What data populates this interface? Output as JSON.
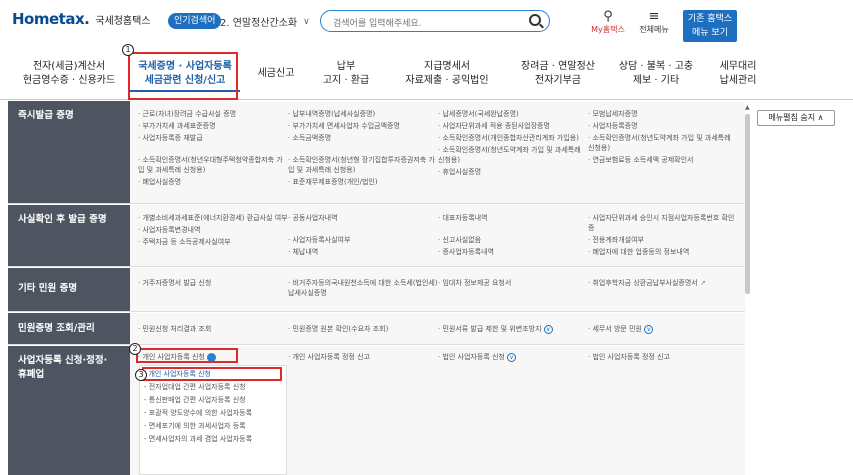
{
  "header": {
    "logo_text": "Hometax.",
    "logo_ko": "국세청홈택스",
    "popular_badge": "인기검색어",
    "popular_selected": "2. 연말정산간소화",
    "search_placeholder": "검색어를 입력해주세요.",
    "my_hometax": "My홈택스",
    "all_menu": "전체메뉴",
    "basic_menu_line1": "기존 홈택스",
    "basic_menu_line2": "메뉴 보기"
  },
  "nav": {
    "items": [
      {
        "line1": "전자(세금)계산서",
        "line2": "현금영수증 · 신용카드"
      },
      {
        "line1": "국세증명 · 사업자등록",
        "line2": "세금관련 신청/신고"
      },
      {
        "line1": "세금신고",
        "line2": ""
      },
      {
        "line1": "납부",
        "line2": "고지 · 환급"
      },
      {
        "line1": "지급명세서",
        "line2": "자료제출 · 공익법인"
      },
      {
        "line1": "장려금 · 연말정산",
        "line2": "전자기부금"
      },
      {
        "line1": "상담 · 불복 · 고충",
        "line2": "제보 · 기타"
      },
      {
        "line1": "세무대리",
        "line2": "납세관리"
      }
    ]
  },
  "annotations": {
    "n1": "1",
    "n2": "2",
    "n3": "3"
  },
  "sections": {
    "s1": {
      "label": "즉시발급 증명",
      "c1": [
        "· 근로(자녀)장려금 수급사실 증명",
        "· 부가가치세 과세표준증명",
        "· 사업자등록증 재발급",
        "· 소득확인증명서(청년우대형주택청약종합저축 가입 및 과세특례 신청용)",
        "· 폐업사실증명"
      ],
      "c2": [
        "· 납부내역증명(납세사실증명)",
        "· 부가가치세 면세사업자 수입금액증명",
        "· 소득금액증명",
        "· 소득확인증명서(청년형 장기집합투자증권저축 가입 및 과세특례 신청용)",
        "· 표준재무제표증명(개인/법인)"
      ],
      "c3": [
        "· 납세증명서(국세완납증명)",
        "· 사업자단위과세 적용 종된사업장증명",
        "· 소득확인증명서(개인종합자산관리계좌 가입용)",
        "· 소득확인증명서(청년도약계좌 가입 및 과세특례 신청용)",
        "· 휴업사실증명"
      ],
      "c4": [
        "· 모범납세자증명",
        "· 사업자등록증명",
        "· 소득확인증명서(청년도약계좌 가입 및 과세특례 신청용)",
        "· 연금보험료등 소득세액 공제확인서"
      ]
    },
    "s2": {
      "label": "사실확인 후 발급 증명",
      "c1": [
        "· 개별소비세과세표준(에너지환경세) 환급사실 여부",
        "· 사업자등록변경내역",
        "· 주택자금 등 소득공제사실여부"
      ],
      "c2": [
        "· 공동사업자내역",
        "· 사업자등록사실여부",
        "· 체납내역"
      ],
      "c3": [
        "· 대표자등록내역",
        "· 신고사실없음",
        "· 증사업자등록내역"
      ],
      "c4": [
        "· 사업자단위과세 승인시 지점사업자등록번호 확인증",
        "· 전용계좌개설여부",
        "· 폐업자에 대한 업종등의 정보내역"
      ]
    },
    "s3": {
      "label": "기타 민원 증명",
      "c1": [
        "· 거주자증명서 발급 신청"
      ],
      "c2": [
        "· 비거주자등의국내원천소득에 대한 소득세(법인세) 납세사실증명"
      ],
      "c3": [
        "· 임대차 정보제공 요청서"
      ],
      "c4": [
        "· 취업후학자금 상환금납부사실증명서"
      ]
    },
    "s4": {
      "label": "민원증명 조회/관리",
      "c1": [
        "· 민원신청 처리결과 조회"
      ],
      "c2": [
        "· 민원증명 원본 확인(수요자 조회)"
      ],
      "c3": [
        "· 민원서류 발급 제한 및 위변조방지"
      ],
      "c4": [
        "· 세무서 방문 민원"
      ]
    },
    "s5": {
      "label_line1": "사업자등록 신청·정정·",
      "label_line2": "휴폐업",
      "c1": [
        "· 개인 사업자등록 신청"
      ],
      "c2": [
        "· 개인 사업자등록 정정 신고"
      ],
      "c3": [
        "· 법인 사업자등록 신청"
      ],
      "c4": [
        "· 법인 사업자등록 정정 신고"
      ]
    }
  },
  "sub_panel": [
    "· 개인 사업자등록 신청",
    "- 전자업대업 간편 사업자등록 신청",
    "- 통신판매업 간편 사업자등록 신청",
    "- 포괄적 양도양수에 의한 사업자등록",
    "- 면세포기에 의한 과세사업자 등록",
    "- 면세사업자의 과세 겸업 사업자등록"
  ],
  "menu_toggle": "메뉴펼침 숨지 ∧"
}
